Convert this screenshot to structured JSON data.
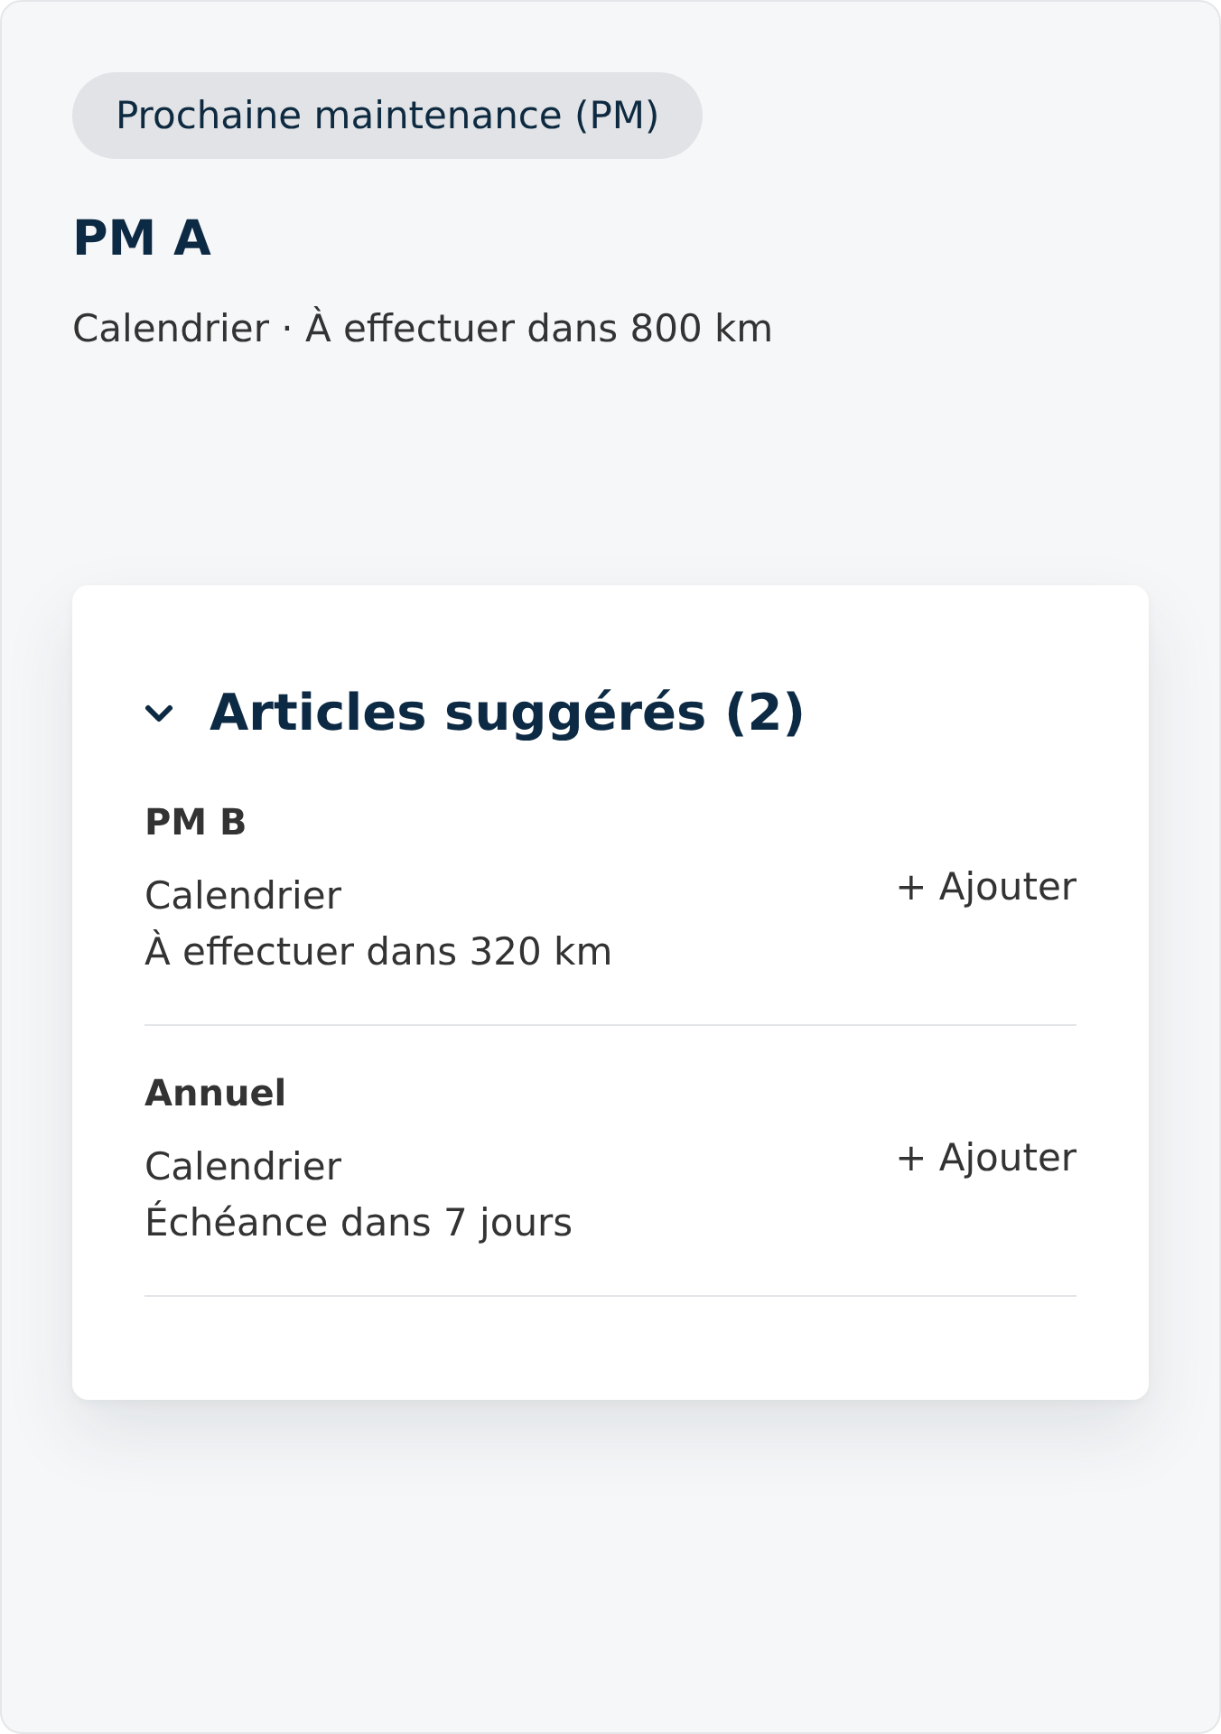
{
  "badge": {
    "label": "Prochaine maintenance (PM)"
  },
  "current": {
    "title": "PM A",
    "subtitle": "Calendrier · À effectuer dans 800 km"
  },
  "suggestions": {
    "title": "Articles suggérés (2)",
    "expanded": true,
    "items": [
      {
        "name": "PM B",
        "lines": [
          "Calendrier",
          "À effectuer dans 320 km"
        ],
        "action": "+ Ajouter"
      },
      {
        "name": "Annuel",
        "lines": [
          "Calendrier",
          "Échéance dans 7 jours"
        ],
        "action": "+ Ajouter"
      }
    ]
  }
}
